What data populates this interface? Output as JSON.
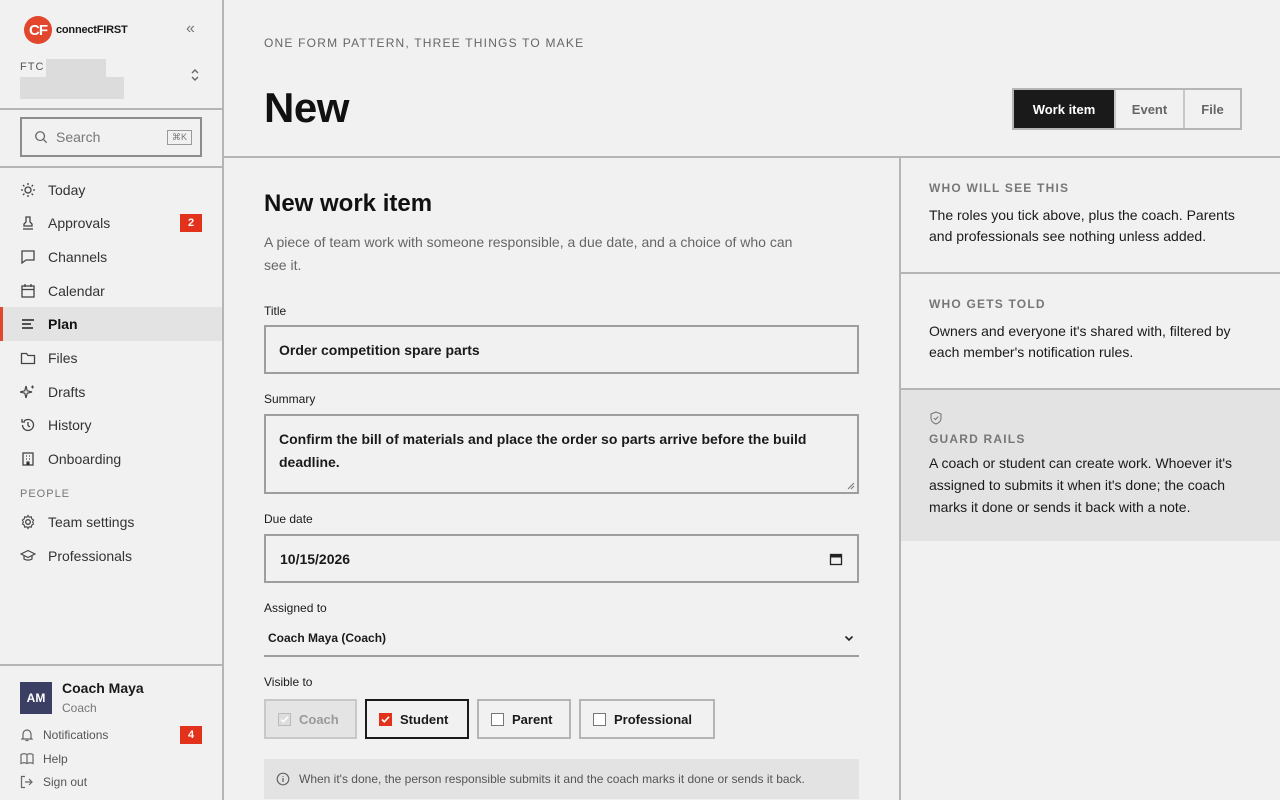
{
  "brand": {
    "logo_mark": "CF",
    "logo_text": "connectFIRST",
    "color": "#e2462c"
  },
  "team": {
    "code": "FTC"
  },
  "search": {
    "placeholder": "Search",
    "shortcut": "⌘K"
  },
  "nav": [
    {
      "label": "Today",
      "icon": "sun-icon"
    },
    {
      "label": "Approvals",
      "icon": "stamp-icon",
      "badge": "2"
    },
    {
      "label": "Channels",
      "icon": "chat-icon"
    },
    {
      "label": "Calendar",
      "icon": "calendar-icon"
    },
    {
      "label": "Plan",
      "icon": "list-icon",
      "active": true
    },
    {
      "label": "Files",
      "icon": "folder-icon"
    },
    {
      "label": "Drafts",
      "icon": "sparkle-icon"
    },
    {
      "label": "History",
      "icon": "history-icon"
    },
    {
      "label": "Onboarding",
      "icon": "building-icon"
    }
  ],
  "people": {
    "section_label": "PEOPLE",
    "items": [
      {
        "label": "Team settings",
        "icon": "gear-icon"
      },
      {
        "label": "Professionals",
        "icon": "graduation-cap-icon"
      }
    ]
  },
  "user": {
    "initials": "AM",
    "name": "Coach Maya",
    "role": "Coach"
  },
  "footer": {
    "notifications": "Notifications",
    "notifications_badge": "4",
    "help": "Help",
    "sign_out": "Sign out"
  },
  "header": {
    "eyebrow": "ONE FORM PATTERN, THREE THINGS TO MAKE",
    "title": "New",
    "tabs": [
      {
        "label": "Work item",
        "active": true
      },
      {
        "label": "Event"
      },
      {
        "label": "File"
      }
    ]
  },
  "form": {
    "title": "New work item",
    "subtitle": "A piece of team work with someone responsible, a due date, and a choice of who can see it.",
    "title_label": "Title",
    "title_value": "Order competition spare parts",
    "summary_label": "Summary",
    "summary_value": "Confirm the bill of materials and place the order so parts arrive before the build deadline.",
    "due_label": "Due date",
    "due_value": "10/15/2026",
    "assigned_label": "Assigned to",
    "assigned_value": "Coach Maya (Coach)",
    "visible_label": "Visible to",
    "visibility": [
      {
        "label": "Coach",
        "checked": true,
        "disabled": true
      },
      {
        "label": "Student",
        "checked": true
      },
      {
        "label": "Parent",
        "checked": false
      },
      {
        "label": "Professional",
        "checked": false
      }
    ],
    "note": "When it's done, the person responsible submits it and the coach marks it done or sends it back."
  },
  "panel": {
    "who_sees_title": "WHO WILL SEE THIS",
    "who_sees_text": "The roles you tick above, plus the coach. Parents and professionals see nothing unless added.",
    "who_told_title": "WHO GETS TOLD",
    "who_told_text": "Owners and everyone it's shared with, filtered by each member's notification rules.",
    "guard_title": "GUARD RAILS",
    "guard_text": "A coach or student can create work. Whoever it's assigned to submits it when it's done; the coach marks it done or sends it back with a note."
  }
}
